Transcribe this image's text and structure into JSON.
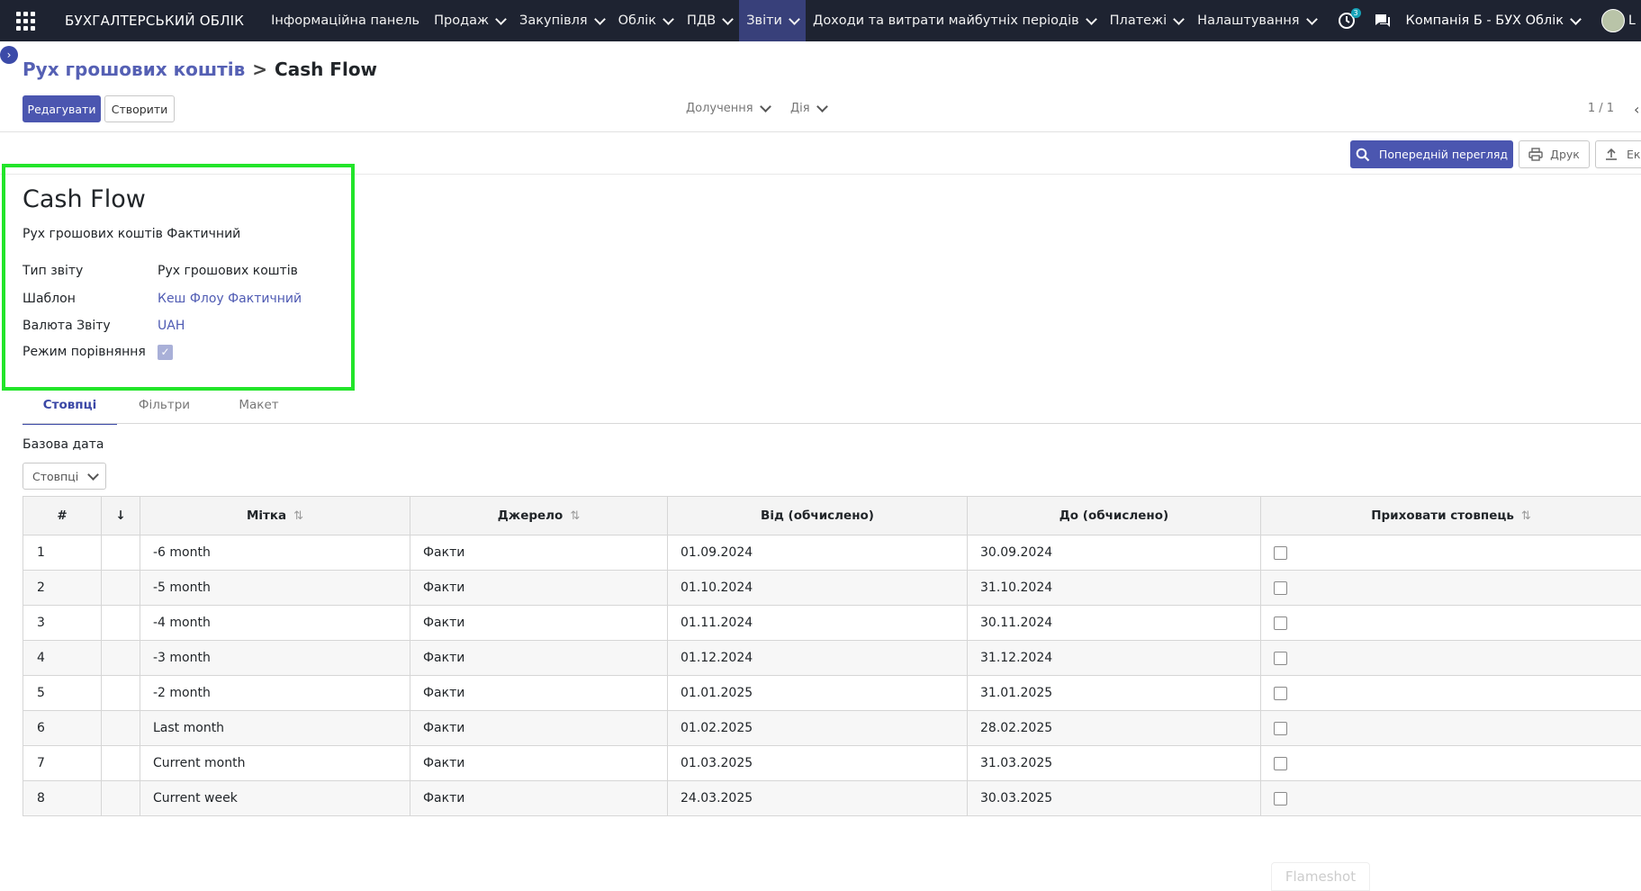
{
  "navbar": {
    "brand": "БУХГАЛТЕРСЬКИЙ ОБЛІК",
    "menu": [
      {
        "label": "Інформаційна панель",
        "caret": false
      },
      {
        "label": "Продаж",
        "caret": true
      },
      {
        "label": "Закупівля",
        "caret": true
      },
      {
        "label": "Облік",
        "caret": true
      },
      {
        "label": "ПДВ",
        "caret": true
      },
      {
        "label": "Звіти",
        "caret": true
      },
      {
        "label": "Доходи та витрати майбутніх періодів",
        "caret": true
      },
      {
        "label": "Платежі",
        "caret": true
      },
      {
        "label": "Налаштування",
        "caret": true
      }
    ],
    "activity_badge": "3",
    "company": "Компанія Б - БУХ Облік",
    "user_initial": "L"
  },
  "breadcrumb": {
    "parent": "Рух грошових коштів",
    "current": "Cash Flow"
  },
  "control": {
    "edit_label": "Редагувати",
    "create_label": "Створити",
    "attachments_label": "Долучення",
    "action_label": "Дія",
    "pager": "1 / 1"
  },
  "form_buttons": {
    "preview_label": "Попередній перегляд",
    "print_label": "Друк",
    "export_label": "Ек"
  },
  "sheet": {
    "title": "Cash Flow",
    "subtitle": "Рух грошових коштів Фактичний",
    "fields": {
      "report_type_label": "Тип звіту",
      "report_type_value": "Рух грошових коштів",
      "template_label": "Шаблон",
      "template_value": "Кеш Флоу Фактичний",
      "currency_label": "Валюта Звіту",
      "currency_value": "UAH",
      "comparison_label": "Режим порівняння",
      "comparison_checked": true
    }
  },
  "tabs": [
    {
      "label": "Стовпці",
      "active": true
    },
    {
      "label": "Фільтри",
      "active": false
    },
    {
      "label": "Макет",
      "active": false
    }
  ],
  "base_date_label": "Базова дата",
  "columns_button": "Стовпці",
  "table": {
    "headers": {
      "num": "#",
      "sort": "↓",
      "label": "Мітка",
      "source": "Джерело",
      "from": "Від (обчислено)",
      "to": "До (обчислено)",
      "hide": "Приховати стовпець"
    },
    "rows": [
      {
        "num": "1",
        "label": "-6 month",
        "source": "Факти",
        "from": "01.09.2024",
        "to": "30.09.2024",
        "hidden": false
      },
      {
        "num": "2",
        "label": "-5 month",
        "source": "Факти",
        "from": "01.10.2024",
        "to": "31.10.2024",
        "hidden": false
      },
      {
        "num": "3",
        "label": "-4 month",
        "source": "Факти",
        "from": "01.11.2024",
        "to": "30.11.2024",
        "hidden": false
      },
      {
        "num": "4",
        "label": "-3 month",
        "source": "Факти",
        "from": "01.12.2024",
        "to": "31.12.2024",
        "hidden": false
      },
      {
        "num": "5",
        "label": "-2 month",
        "source": "Факти",
        "from": "01.01.2025",
        "to": "31.01.2025",
        "hidden": false
      },
      {
        "num": "6",
        "label": "Last month",
        "source": "Факти",
        "from": "01.02.2025",
        "to": "28.02.2025",
        "hidden": false
      },
      {
        "num": "7",
        "label": "Current month",
        "source": "Факти",
        "from": "01.03.2025",
        "to": "31.03.2025",
        "hidden": false
      },
      {
        "num": "8",
        "label": "Current week",
        "source": "Факти",
        "from": "24.03.2025",
        "to": "30.03.2025",
        "hidden": false
      }
    ]
  },
  "watermark": "Flameshot",
  "colors": {
    "navbar_bg": "#1e2331",
    "primary": "#4b56b0",
    "highlight": "#22e52a"
  }
}
